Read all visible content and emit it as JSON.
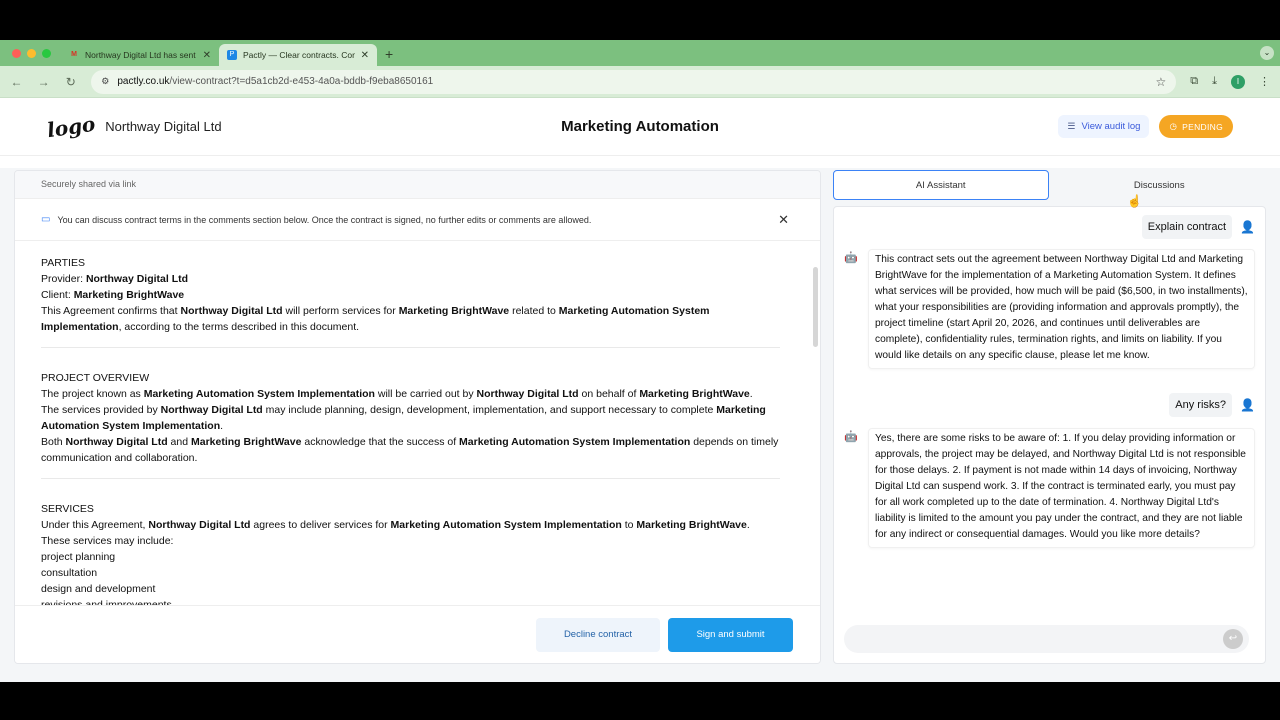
{
  "browser": {
    "tabs": [
      {
        "label": "Northway Digital Ltd has sent",
        "favicon": "M",
        "favicon_color": "#d93025",
        "active": false
      },
      {
        "label": "Pactly — Clear contracts. Con",
        "favicon": "P",
        "favicon_color": "#1e88e5",
        "active": true
      }
    ],
    "url_host": "pactly.co.uk",
    "url_path": "/view-contract?t=d5a1cb2d-e453-4a0a-bddb-f9eba8650161",
    "profile_initial": "I"
  },
  "header": {
    "logo_text": "logo",
    "company": "Northway Digital Ltd",
    "title": "Marketing Automation",
    "audit_label": "View audit log",
    "status_label": "PENDING",
    "status_color": "#f5a623"
  },
  "left": {
    "shared_note": "Securely shared via link",
    "banner_text": "You can discuss contract terms in the comments section below. Once the contract is signed, no further edits or comments are allowed.",
    "sections": {
      "parties": {
        "title": "PARTIES",
        "provider_label": "Provider: ",
        "provider": "Northway Digital Ltd",
        "client_label": "Client: ",
        "client": "Marketing BrightWave",
        "p1": "This Agreement confirms that ",
        "p2": "Northway Digital Ltd",
        "p3": " will perform services for ",
        "p4": "Marketing BrightWave",
        "p5": " related to ",
        "p6": "Marketing Automation System Implementation",
        "p7": ", according to the terms described in this document."
      },
      "overview": {
        "title": "PROJECT OVERVIEW",
        "a1": "The project known as ",
        "a2": "Marketing Automation System Implementation",
        "a3": " will be carried out by ",
        "a4": "Northway Digital Ltd",
        "a5": " on behalf of ",
        "a6": "Marketing BrightWave",
        "a7": ".",
        "b1": "The services provided by ",
        "b2": "Northway Digital Ltd",
        "b3": " may include planning, design, development, implementation, and support necessary to complete ",
        "b4": "Marketing Automation System Implementation",
        "b5": ".",
        "c1": "Both ",
        "c2": "Northway Digital Ltd",
        "c3": " and ",
        "c4": "Marketing BrightWave",
        "c5": " acknowledge that the success of ",
        "c6": "Marketing Automation System Implementation",
        "c7": " depends on timely communication and collaboration."
      },
      "services": {
        "title": "SERVICES",
        "a1": "Under this Agreement, ",
        "a2": "Northway Digital Ltd",
        "a3": " agrees to deliver services for ",
        "a4": "Marketing Automation System Implementation",
        "a5": " to ",
        "a6": "Marketing BrightWave",
        "a7": ".",
        "intro": "These services may include:",
        "items": [
          "project planning",
          "consultation",
          "design and development",
          "revisions and improvements"
        ]
      }
    },
    "decline_label": "Decline contract",
    "sign_label": "Sign and submit"
  },
  "right": {
    "tab_ai": "AI Assistant",
    "tab_discussions": "Discussions",
    "messages": [
      {
        "role": "user",
        "text": "Explain contract"
      },
      {
        "role": "bot",
        "text": "This contract sets out the agreement between Northway Digital Ltd and Marketing BrightWave for the implementation of a Marketing Automation System. It defines what services will be provided, how much will be paid ($6,500, in two installments), what your responsibilities are (providing information and approvals promptly), the project timeline (start April 20, 2026, and continues until deliverables are complete), confidentiality rules, termination rights, and limits on liability. If you would like details on any specific clause, please let me know."
      },
      {
        "role": "user",
        "text": "Any risks?"
      },
      {
        "role": "bot",
        "text": "Yes, there are some risks to be aware of: 1. If you delay providing information or approvals, the project may be delayed, and Northway Digital Ltd is not responsible for those delays. 2. If payment is not made within 14 days of invoicing, Northway Digital Ltd can suspend work. 3. If the contract is terminated early, you must pay for all work completed up to the date of termination. 4. Northway Digital Ltd's liability is limited to the amount you pay under the contract, and they are not liable for any indirect or consequential damages. Would you like more details?"
      }
    ],
    "input_value": "",
    "input_placeholder": ""
  }
}
